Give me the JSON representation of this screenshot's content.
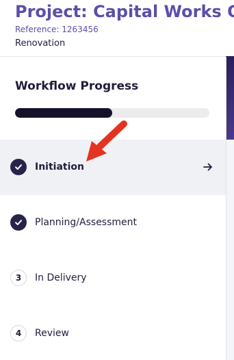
{
  "header": {
    "project_title": "Project: Capital Works Oc",
    "reference": "Reference: 1263456",
    "category": "Renovation"
  },
  "workflow": {
    "title": "Workflow Progress",
    "progress_fraction": 0.5,
    "steps": [
      {
        "label": "Initiation",
        "state": "complete",
        "active": true,
        "icon": "check-icon"
      },
      {
        "label": "Planning/Assessment",
        "state": "complete",
        "active": false,
        "icon": "check-icon"
      },
      {
        "label": "In Delivery",
        "state": "pending",
        "active": false,
        "number": "3"
      },
      {
        "label": "Review",
        "state": "pending",
        "active": false,
        "number": "4"
      }
    ]
  },
  "icons": {
    "active_step_arrow": "arrow-right-icon",
    "annotation": "red-pointer-arrow"
  },
  "colors": {
    "brand": "#5a4fa8",
    "progress": "#14122b",
    "step_done": "#27244a",
    "annotation": "#e53322"
  }
}
